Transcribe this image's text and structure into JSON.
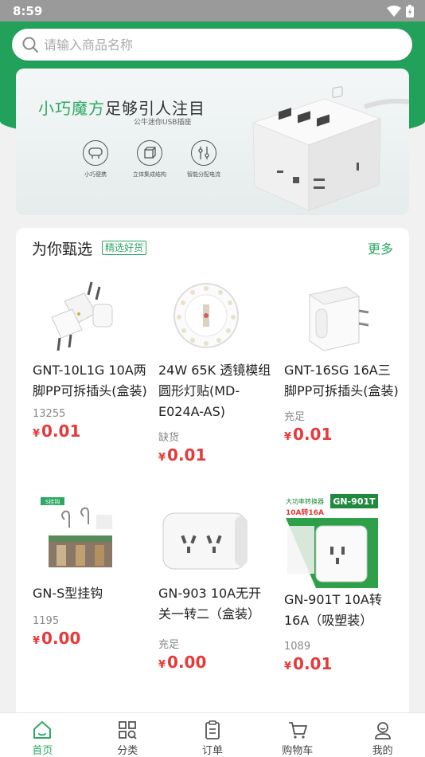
{
  "status": {
    "time": "8:59"
  },
  "search": {
    "placeholder": "请输入商品名称"
  },
  "banner": {
    "title_green": "小巧魔方",
    "title_rest": "足够引人注目",
    "subtitle": "公牛迷你USB插座",
    "features": [
      "小巧便携",
      "立体集成结构",
      "智能分配电流"
    ]
  },
  "section": {
    "title": "为你甄选",
    "tag": "精选好货",
    "more": "更多"
  },
  "products": [
    {
      "name": "GNT-10L1G 10A两脚PP可拆插头(盒装)",
      "stock": "13255",
      "currency": "¥",
      "price": "0.01"
    },
    {
      "name": "24W 65K 透镜模组圆形灯贴(MD-E024A-AS)",
      "stock": "缺货",
      "currency": "¥",
      "price": "0.01"
    },
    {
      "name": "GNT-16SG 16A三脚PP可拆插头(盒装)",
      "stock": "充足",
      "currency": "¥",
      "price": "0.01"
    },
    {
      "name": "GN-S型挂钩",
      "stock": "1195",
      "currency": "¥",
      "price": "0.00",
      "img_tag": "S挂钩"
    },
    {
      "name": "GN-903 10A无开关一转二（盒装）",
      "stock": "充足",
      "currency": "¥",
      "price": "0.00"
    },
    {
      "name": "GN-901T 10A转16A（吸塑装）",
      "stock": "1089",
      "currency": "¥",
      "price": "0.01",
      "img_title": "GN-901T",
      "img_sub": "大功率转换器",
      "img_sub2": "10A转16A"
    }
  ],
  "tabs": [
    {
      "label": "首页",
      "icon": "home-icon",
      "active": true
    },
    {
      "label": "分类",
      "icon": "category-icon"
    },
    {
      "label": "订单",
      "icon": "order-icon"
    },
    {
      "label": "购物车",
      "icon": "cart-icon"
    },
    {
      "label": "我的",
      "icon": "profile-icon"
    }
  ],
  "colors": {
    "brand_green": "#22a15a",
    "price_red": "#e63a3a"
  }
}
